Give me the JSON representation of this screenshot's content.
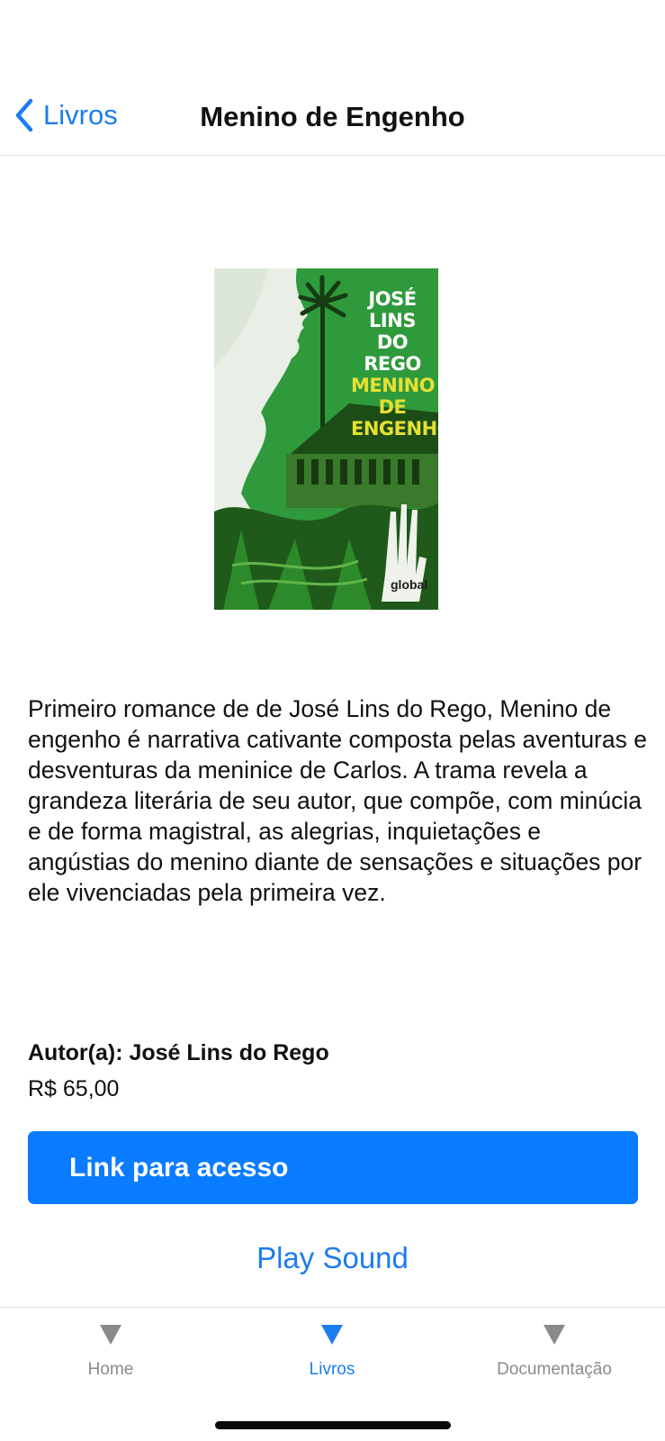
{
  "nav": {
    "back_label": "Livros",
    "title": "Menino de Engenho"
  },
  "book": {
    "cover": {
      "author_text": "JOSÉ LINS DO REGO",
      "title_text": "MENINO DE ENGENHO",
      "publisher": "global"
    },
    "description": "Primeiro romance de de José Lins do Rego, Menino de engenho é narrativa cativante composta pelas aventuras e desventuras da meninice de Carlos. A trama revela a grandeza literária de seu autor, que compõe, com minúcia e de forma magistral, as alegrias, inquietações e angústias do menino diante de sensações e situações por ele vivenciadas pela primeira vez.",
    "author_line": "Autor(a): José Lins do Rego",
    "price": "R$ 65,00"
  },
  "actions": {
    "access_label": "Link para acesso",
    "play_sound_label": "Play Sound"
  },
  "tabbar": {
    "tabs": [
      {
        "label": "Home",
        "icon": "triangle-down-icon",
        "active": false
      },
      {
        "label": "Livros",
        "icon": "triangle-down-icon",
        "active": true
      },
      {
        "label": "Documentação",
        "icon": "triangle-down-icon",
        "active": false
      }
    ]
  },
  "colors": {
    "accent": "#0a7cff",
    "link": "#1c7cf0",
    "inactive_tab": "#8a8a8a",
    "cover_green": "#2e8b3a"
  }
}
